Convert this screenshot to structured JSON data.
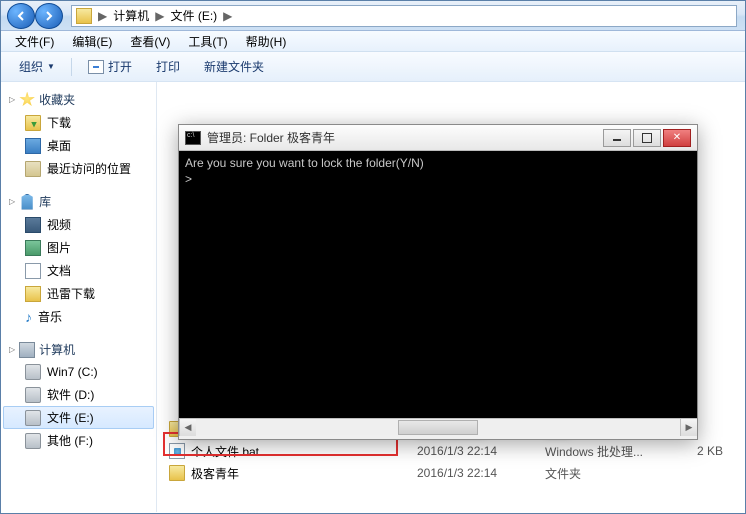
{
  "addr": {
    "seg1": "计算机",
    "seg2": "文件 (E:)",
    "sep": "▶"
  },
  "menu": {
    "file": "文件(F)",
    "edit": "编辑(E)",
    "view": "查看(V)",
    "tools": "工具(T)",
    "help": "帮助(H)"
  },
  "toolbar": {
    "org": "组织",
    "open": "打开",
    "print": "打印",
    "newfolder": "新建文件夹"
  },
  "sidebar": {
    "fav": "收藏夹",
    "download": "下载",
    "desktop": "桌面",
    "recent": "最近访问的位置",
    "lib": "库",
    "video": "视频",
    "pictures": "图片",
    "docs": "文档",
    "thunder": "迅雷下载",
    "music": "音乐",
    "computer": "计算机",
    "c": "Win7 (C:)",
    "d": "软件 (D:)",
    "e": "文件 (E:)",
    "f": "其他 (F:)"
  },
  "files": [
    {
      "name": "个人文件.bat",
      "date": "2016/1/3 22:14",
      "type": "Windows 批处理...",
      "size": "2 KB"
    },
    {
      "name": "极客青年",
      "date": "2016/1/3 22:14",
      "type": "文件夹",
      "size": ""
    }
  ],
  "cmd": {
    "title": "管理员: Folder 极客青年",
    "line1": "Are you sure you want to lock the folder(Y/N)",
    "prompt": ">"
  }
}
